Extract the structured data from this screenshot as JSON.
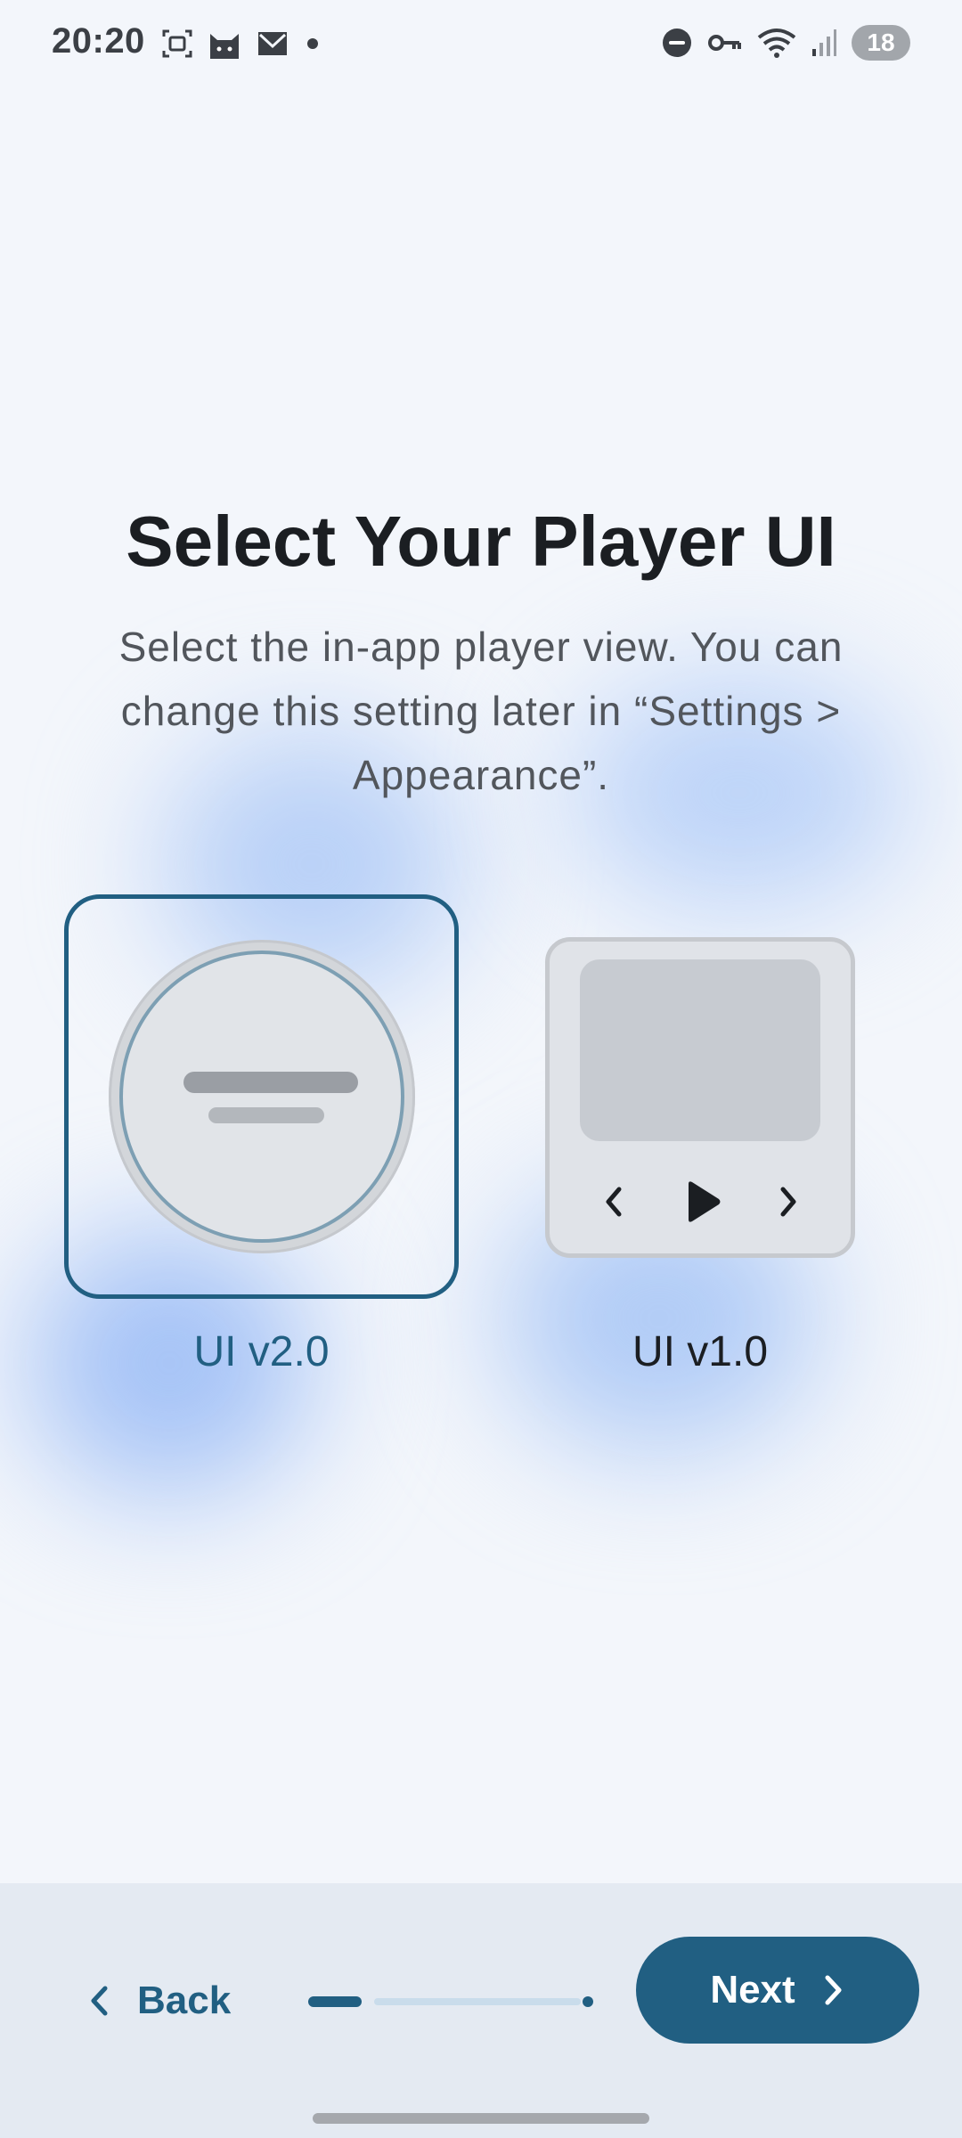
{
  "status_bar": {
    "time": "20:20",
    "battery": "18",
    "left_icons": [
      "screenshot-icon",
      "cat-icon",
      "mail-icon",
      "dot-icon"
    ],
    "right_icons": [
      "do-not-disturb-icon",
      "vpn-key-icon",
      "wifi-icon",
      "signal-icon",
      "battery-icon"
    ]
  },
  "onboarding": {
    "title": "Select Your Player UI",
    "subtitle": "Select the in-app player view. You can change this setting later in “Settings > Appearance”."
  },
  "options": [
    {
      "label": "UI v2.0",
      "selected": true
    },
    {
      "label": "UI v1.0",
      "selected": false
    }
  ],
  "navigation": {
    "back_label": "Back",
    "next_label": "Next",
    "progress_fraction": 0.2
  },
  "colors": {
    "accent": "#215f82",
    "background": "#f3f6fb",
    "bottom_bar": "#e4eaf2"
  }
}
